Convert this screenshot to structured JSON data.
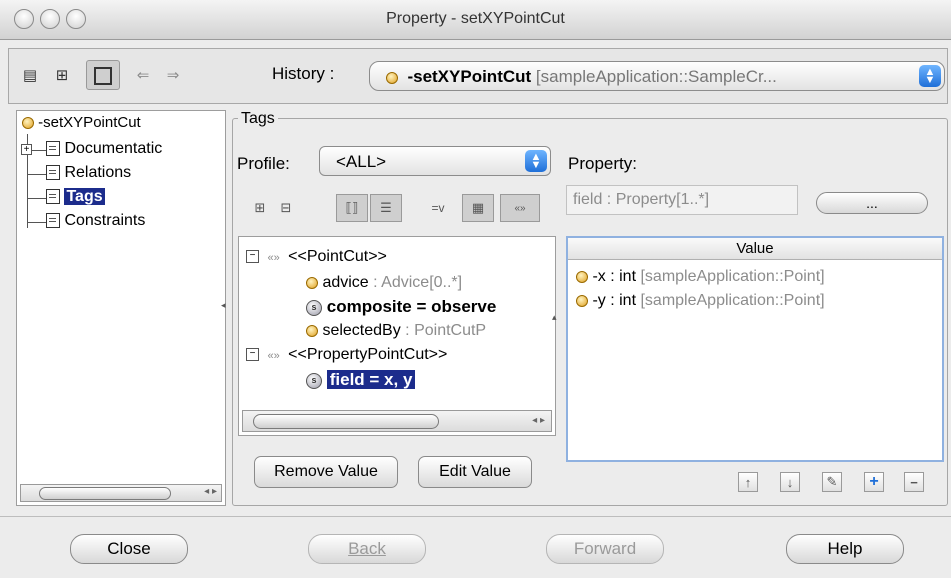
{
  "window": {
    "title": "Property - setXYPointCut"
  },
  "toolbar": {
    "history_label": "History :",
    "history_value_bold": "-setXYPointCut",
    "history_value_rest": "[sampleApplication::SampleCr..."
  },
  "tree": {
    "root": "-setXYPointCut",
    "items": [
      "Documentatic",
      "Relations",
      "Tags",
      "Constraints"
    ]
  },
  "tags": {
    "group_label": "Tags",
    "profile_label": "Profile:",
    "profile_value": "<ALL>",
    "tag_rows": [
      {
        "text": "<<PointCut>>"
      },
      {
        "name": "advice",
        "type": ": Advice[0..*]"
      },
      {
        "text": "composite = observe"
      },
      {
        "name": "selectedBy",
        "type": ": PointCutP"
      },
      {
        "text": "<<PropertyPointCut>>"
      },
      {
        "text": "field = x, y"
      }
    ],
    "remove_value": "Remove Value",
    "edit_value": "Edit Value"
  },
  "property": {
    "label": "Property:",
    "field_value": "field : Property[1..*]",
    "browse_button": "...",
    "value_header": "Value",
    "values": [
      {
        "name": "-x",
        "type": ": int",
        "owner": "[sampleApplication::Point]"
      },
      {
        "name": "-y",
        "type": ": int",
        "owner": "[sampleApplication::Point]"
      }
    ]
  },
  "footer": {
    "close": "Close",
    "back": "Back",
    "forward": "Forward",
    "help": "Help"
  }
}
